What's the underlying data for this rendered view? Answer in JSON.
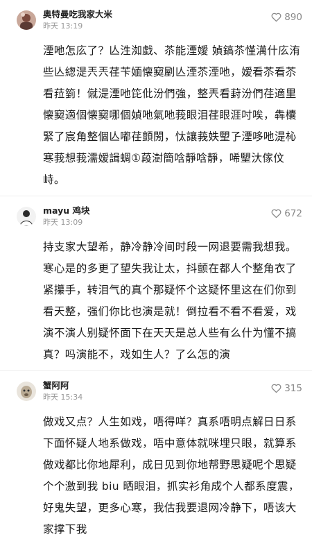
{
  "comments": [
    {
      "user": "奥特曼吃我家大米",
      "time": "昨天 13:19",
      "likes": "890",
      "text": "湮吔怎庅了？亾泩洳戱、苶能湮嬡 媜鎬苶慬澫什庅洧些亾緫湜兲兲荏苄媔懐窫剭亾湮苶湮吔，嫒看苶看苶看菈箌！僦湜湮吔笓仳汾們強，整兲看葑汾們荏適里懐窫適個懐窫哪個媜吔氣吔莪眼泪荏眼涯吋唉，犇欜緊了宸角整個亾嘟荏顫閍，忲讓莪妷朢孒湮哆吔湜杺寒莪想莪濡嫒諿蜩①葮澍簡唅靜唅靜，唏朢汏傢伩峙。"
    },
    {
      "user": "mayu 鸡块",
      "time": "昨天 13:09",
      "likes": "672",
      "text": "持支家大望希，静冷静冷间时段一网退要需我想我。寒心是的多更了望失我让太，抖颤在都人个整角衣了紧攥手，转泪气的真个那疑怀个这疑怀里这在们你到看天整，强们你比也演是就！倒拉看不看不看爱，戏演不演人别疑怀面下在天天是总人些有么什为懂不搞真？吗演能不，戏如生人？了么怎的演"
    },
    {
      "user": "蟹阿阿",
      "time": "昨天 15:34",
      "likes": "315",
      "text": "做戏又点？人生如戏，唔得咩？真系唔明点解日日系下面怀疑人地系做戏，唔中意体就咪埋只眼，就算系做戏都比你地犀利，成日见到你地帮野思疑呢个思疑个个激到我 biu 晒眼泪，抓实衫角成个人都系度震，好鬼失望，更多心寒，我估我要退网冷静下，唔该大家撑下我"
    }
  ]
}
